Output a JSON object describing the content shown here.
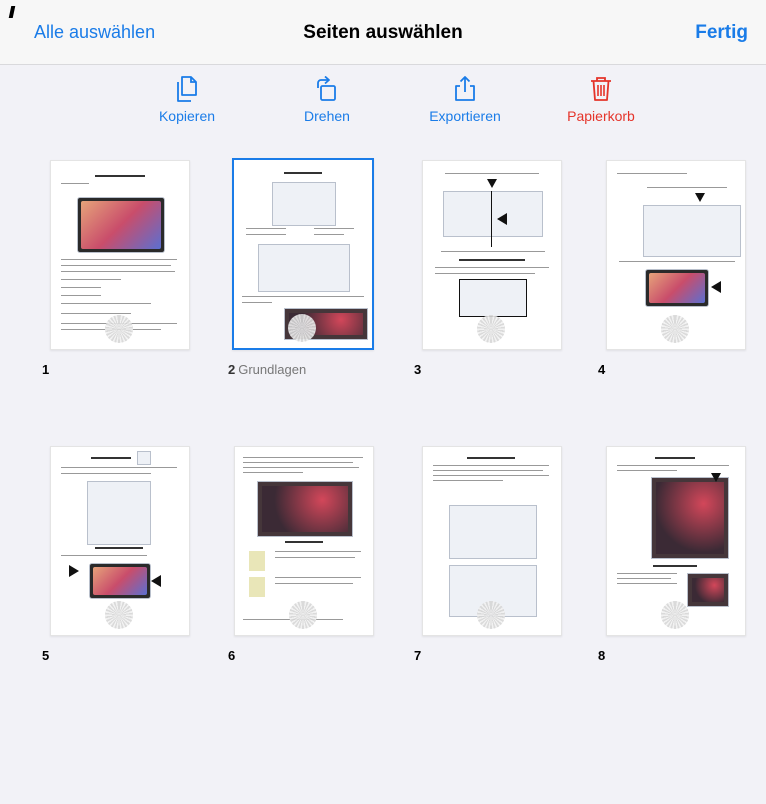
{
  "navbar": {
    "select_all": "Alle auswählen",
    "title": "Seiten auswählen",
    "done": "Fertig"
  },
  "toolbar": {
    "copy": "Kopieren",
    "rotate": "Drehen",
    "export": "Exportieren",
    "trash": "Papierkorb"
  },
  "colors": {
    "accent": "#1a7ce8",
    "destructive": "#e5342a",
    "background": "#f2f2f7"
  },
  "pages": [
    {
      "number": "1",
      "label": "",
      "selected": false
    },
    {
      "number": "2",
      "label": "Grundlagen",
      "selected": true
    },
    {
      "number": "3",
      "label": "",
      "selected": false
    },
    {
      "number": "4",
      "label": "",
      "selected": false
    },
    {
      "number": "5",
      "label": "",
      "selected": false
    },
    {
      "number": "6",
      "label": "",
      "selected": false
    },
    {
      "number": "7",
      "label": "",
      "selected": false
    },
    {
      "number": "8",
      "label": "",
      "selected": false
    }
  ]
}
